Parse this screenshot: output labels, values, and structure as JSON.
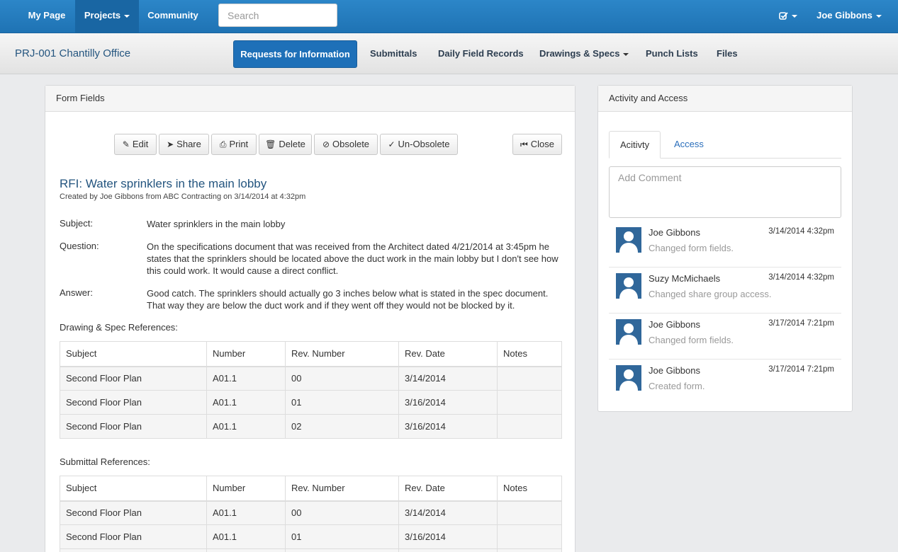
{
  "topnav": {
    "my_page": "My Page",
    "projects": "Projects",
    "community": "Community",
    "search_placeholder": "Search",
    "user": "Joe Gibbons"
  },
  "subnav": {
    "project_title": "PRJ-001 Chantilly Office",
    "tabs": [
      "Requests for Information",
      "Submittals",
      "Daily Field Records",
      "Drawings & Specs",
      "Punch Lists",
      "Files"
    ]
  },
  "form": {
    "panel_title": "Form Fields",
    "buttons": {
      "edit": "Edit",
      "share": "Share",
      "print": "Print",
      "delete": "Delete",
      "obsolete": "Obsolete",
      "unobsolete": "Un-Obsolete",
      "close": "Close"
    },
    "title": "RFI: Water sprinklers in the main lobby",
    "created": "Created by Joe Gibbons from ABC Contracting on 3/14/2014 at 4:32pm",
    "subject_label": "Subject:",
    "subject": "Water sprinklers in the main lobby",
    "question_label": "Question:",
    "question": "On the specifications document that was received from the Architect dated 4/21/2014 at 3:45pm he states that the sprinklers should be located above the duct work in the main lobby but I don't see how this could work. It would cause a direct conflict.",
    "answer_label": "Answer:",
    "answer": "Good catch. The sprinklers should actually go 3 inches below what is stated in the spec document. That way they are below the duct work and if they went off they would not be blocked by it.",
    "drawing_refs_title": "Drawing & Spec References:",
    "submittal_refs_title": "Submittal References:",
    "columns": [
      "Subject",
      "Number",
      "Rev. Number",
      "Rev. Date",
      "Notes"
    ],
    "drawing_rows": [
      [
        "Second Floor Plan",
        "A01.1",
        "00",
        "3/14/2014",
        ""
      ],
      [
        "Second Floor Plan",
        "A01.1",
        "01",
        "3/16/2014",
        ""
      ],
      [
        "Second Floor Plan",
        "A01.1",
        "02",
        "3/16/2014",
        ""
      ]
    ],
    "submittal_rows": [
      [
        "Second Floor Plan",
        "A01.1",
        "00",
        "3/14/2014",
        ""
      ],
      [
        "Second Floor Plan",
        "A01.1",
        "01",
        "3/16/2014",
        ""
      ],
      [
        "",
        "",
        "",
        "",
        ""
      ]
    ]
  },
  "activity": {
    "panel_title": "Activity and Access",
    "tab_activity": "Acitivty",
    "tab_access": "Access",
    "comment_placeholder": "Add Comment",
    "items": [
      {
        "name": "Joe Gibbons",
        "time": "3/14/2014 4:32pm",
        "desc": "Changed form fields."
      },
      {
        "name": "Suzy McMichaels",
        "time": "3/14/2014 4:32pm",
        "desc": "Changed share group access."
      },
      {
        "name": "Joe Gibbons",
        "time": "3/17/2014 7:21pm",
        "desc": "Changed form fields."
      },
      {
        "name": "Joe Gibbons",
        "time": "3/17/2014 7:21pm",
        "desc": "Created form."
      }
    ]
  }
}
